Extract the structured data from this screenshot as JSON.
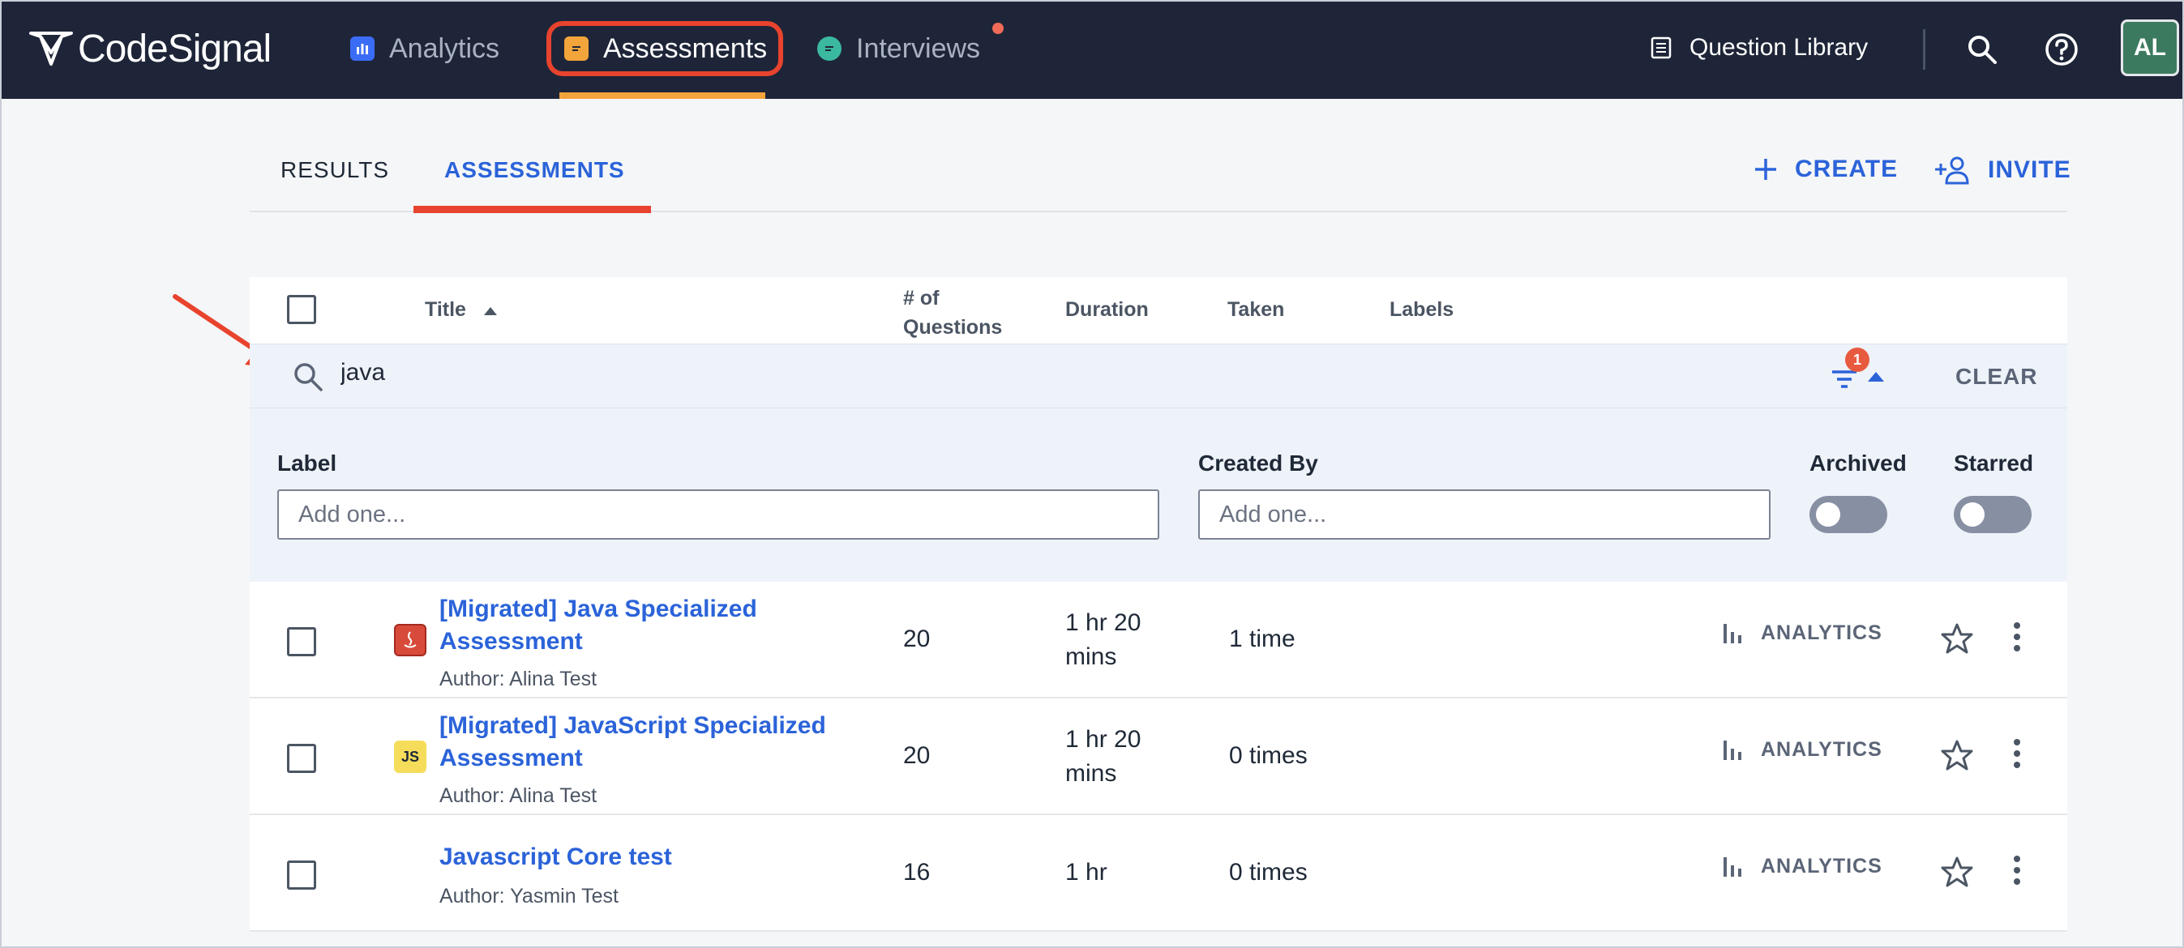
{
  "nav": {
    "logo": "CodeSignal",
    "tabs": [
      {
        "label": "Analytics"
      },
      {
        "label": "Assessments"
      },
      {
        "label": "Interviews"
      }
    ],
    "question_library": "Question Library",
    "avatar_initials": "AL"
  },
  "subtabs": {
    "results": "RESULTS",
    "assessments": "ASSESSMENTS"
  },
  "actions": {
    "create": "CREATE",
    "invite": "INVITE"
  },
  "table": {
    "headers": {
      "title": "Title",
      "questions_line1": "# of",
      "questions_line2": "Questions",
      "duration": "Duration",
      "taken": "Taken",
      "labels": "Labels"
    },
    "search_value": "java",
    "filter_count": "1",
    "clear": "CLEAR",
    "filters": {
      "label": "Label",
      "label_placeholder": "Add one...",
      "created_by": "Created By",
      "created_by_placeholder": "Add one...",
      "archived": "Archived",
      "starred": "Starred"
    },
    "rows": [
      {
        "title_line1": "[Migrated] Java Specialized",
        "title_line2": "Assessment",
        "author": "Author: Alina Test",
        "questions": "20",
        "duration_line1": "1 hr 20",
        "duration_line2": "mins",
        "taken": "1 time",
        "analytics": "ANALYTICS",
        "icon": "java-icon"
      },
      {
        "title_line1": "[Migrated] JavaScript Specialized",
        "title_line2": "Assessment",
        "author": "Author: Alina Test",
        "questions": "20",
        "duration_line1": "1 hr 20",
        "duration_line2": "mins",
        "taken": "0 times",
        "analytics": "ANALYTICS",
        "icon": "js-icon",
        "icon_text": "JS"
      },
      {
        "title_line1": "Javascript Core test",
        "author": "Author: Yasmin Test",
        "questions": "16",
        "duration_line1": "1 hr",
        "taken": "0 times",
        "analytics": "ANALYTICS"
      }
    ]
  },
  "colors": {
    "nav_bg": "#1e2538",
    "accent_blue": "#2b63d9",
    "highlight_red": "#e8432e",
    "assessments_orange": "#f3a43a"
  }
}
